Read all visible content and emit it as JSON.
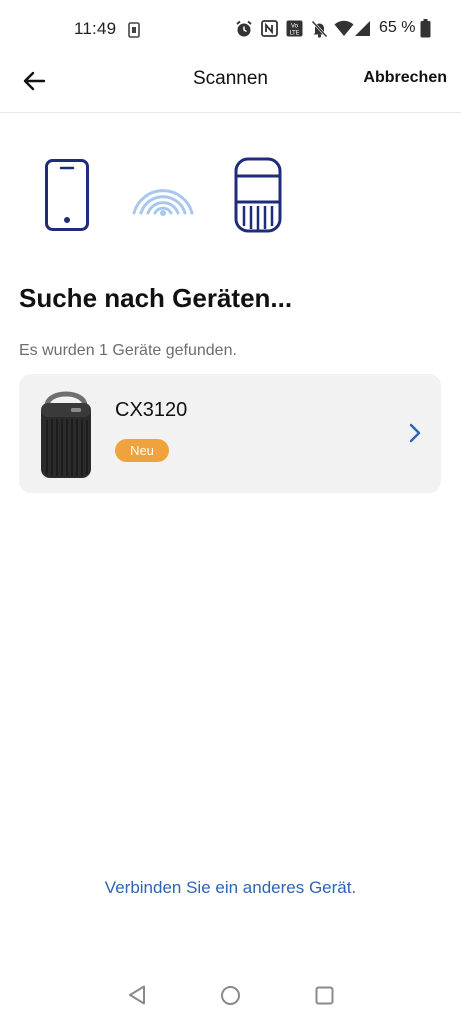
{
  "status_bar": {
    "time": "11:49",
    "battery_percent": "65 %",
    "icons": [
      "sim-card-icon",
      "alarm-icon",
      "nfc-icon",
      "volte-icon",
      "mute-icon",
      "wifi-icon",
      "signal-icon",
      "battery-icon"
    ]
  },
  "header": {
    "title": "Scannen",
    "cancel_label": "Abbrechen",
    "back_icon": "arrow-left-icon"
  },
  "illustration": {
    "icons": [
      "phone-icon",
      "wireless-signal-icon",
      "air-purifier-icon"
    ],
    "accent_color": "#1f2c7a",
    "signal_color": "#a9c6ec"
  },
  "main": {
    "title": "Suche nach Geräten...",
    "found_text": "Es wurden 1 Geräte gefunden.",
    "devices": [
      {
        "name": "CX3120",
        "badge": "Neu",
        "badge_color": "#f0a23c",
        "chevron_icon": "chevron-right-icon"
      }
    ]
  },
  "footer": {
    "link_text": "Verbinden Sie ein anderes Gerät.",
    "link_color": "#2e64b5"
  },
  "nav_bar": {
    "buttons": [
      "back-triangle-icon",
      "home-circle-icon",
      "recents-square-icon"
    ]
  }
}
